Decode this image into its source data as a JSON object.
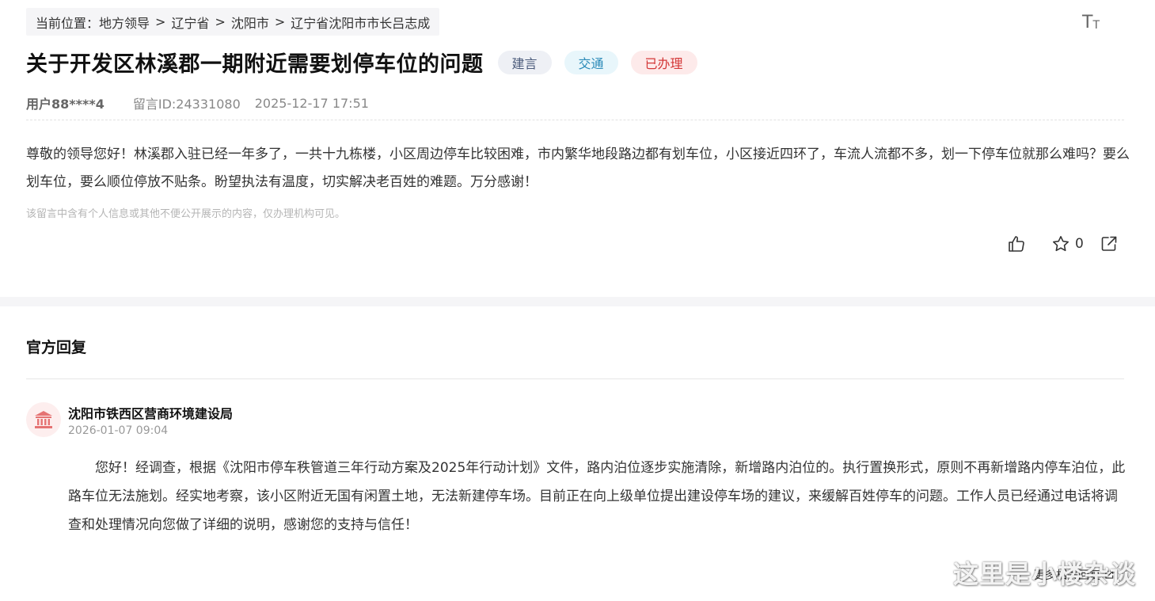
{
  "breadcrumb": {
    "prefix": "当前位置：",
    "items": [
      "地方领导",
      "辽宁省",
      "沈阳市",
      "辽宁省沈阳市市长吕志成"
    ],
    "separator": ">"
  },
  "font_size_control": {
    "icon": "font-size-icon",
    "big": "T",
    "small": "T"
  },
  "message": {
    "title": "关于开发区林溪郡一期附近需要划停车位的问题",
    "tags": [
      {
        "label": "建言",
        "bg": "#eef0f5",
        "color": "#4a5a7a"
      },
      {
        "label": "交通",
        "bg": "#e8f6fb",
        "color": "#2a8ab8"
      },
      {
        "label": "已办理",
        "bg": "#fdeaea",
        "color": "#d43838"
      }
    ],
    "user": "用户88****4",
    "message_id": "留言ID:24331080",
    "datetime": "2025-12-17 17:51",
    "content": "尊敬的领导您好！林溪郡入驻已经一年多了，一共十九栋楼，小区周边停车比较困难，市内繁华地段路边都有划车位，小区接近四环了，车流人流都不多，划一下停车位就那么难吗？要么划车位，要么顺位停放不贴条。盼望执法有温度，切实解决老百姓的难题。万分感谢！",
    "privacy_note": "该留言中含有个人信息或其他不便公开展示的内容，仅办理机构可见。",
    "favorite_count": "0"
  },
  "actions": {
    "like_icon": "thumbs-up-icon",
    "favorite_icon": "star-icon",
    "share_icon": "share-icon"
  },
  "reply": {
    "section_title": "官方回复",
    "org_icon": "government-building-icon",
    "org_name": "沈阳市铁西区营商环境建设局",
    "datetime": "2026-01-07 09:04",
    "content": "您好！经调查，根据《沈阳市停车秩管道三年行动方案及2025年行动计划》文件，路内泊位逐步实施清除，新增路内泊位的。执行置换形式，原则不再新增路内停车泊位，此路车位无法施划。经实地考察，该小区附近无国有闲置土地，无法新建停车场。目前正在向上级单位提出建设停车场的建议，来缓解百姓停车的问题。工作人员已经通过电话将调查和处理情况向您做了详细的说明，感谢您的支持与信任！"
  },
  "footer": {
    "more_label": "更多相关回复",
    "watermark": "这里是小楼杂谈"
  },
  "colors": {
    "accent_red": "#d43838",
    "avatar_bg": "#fdeeee",
    "band": "#f5f5f7"
  }
}
